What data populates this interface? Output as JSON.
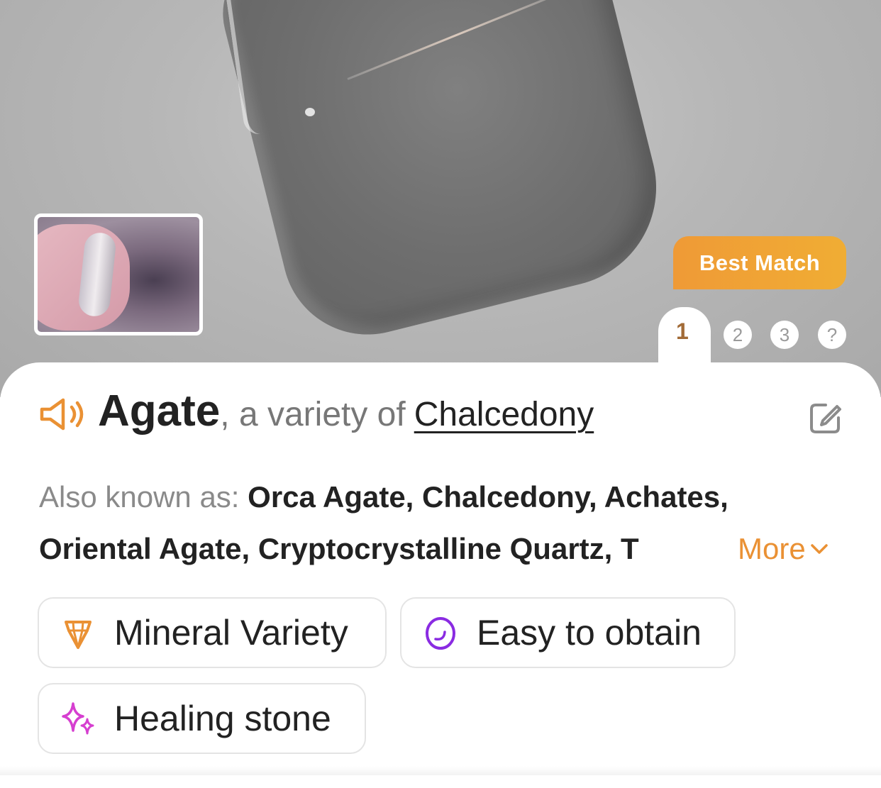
{
  "badge": {
    "label": "Best Match"
  },
  "pager": {
    "active": "1",
    "items": [
      "2",
      "3",
      "?"
    ],
    "active_color": "#a26b37"
  },
  "header": {
    "name": "Agate",
    "variety_prefix": ", a variety of",
    "variety_link": "Chalcedony"
  },
  "aliases": {
    "label": "Also known as: ",
    "values": "Orca Agate, Chalcedony, Achates, Oriental Agate, Cryptocrystalline Quartz, T",
    "more_label": "More"
  },
  "tags": [
    {
      "label": "Mineral Variety",
      "icon": "crystal-icon",
      "color": "#ea9134"
    },
    {
      "label": "Easy to obtain",
      "icon": "stone-icon",
      "color": "#8a2be2"
    },
    {
      "label": "Healing stone",
      "icon": "sparkle-icon",
      "color": "#d63fd0"
    }
  ],
  "colors": {
    "accent": "#ea9134",
    "badge": "#f0a235"
  }
}
